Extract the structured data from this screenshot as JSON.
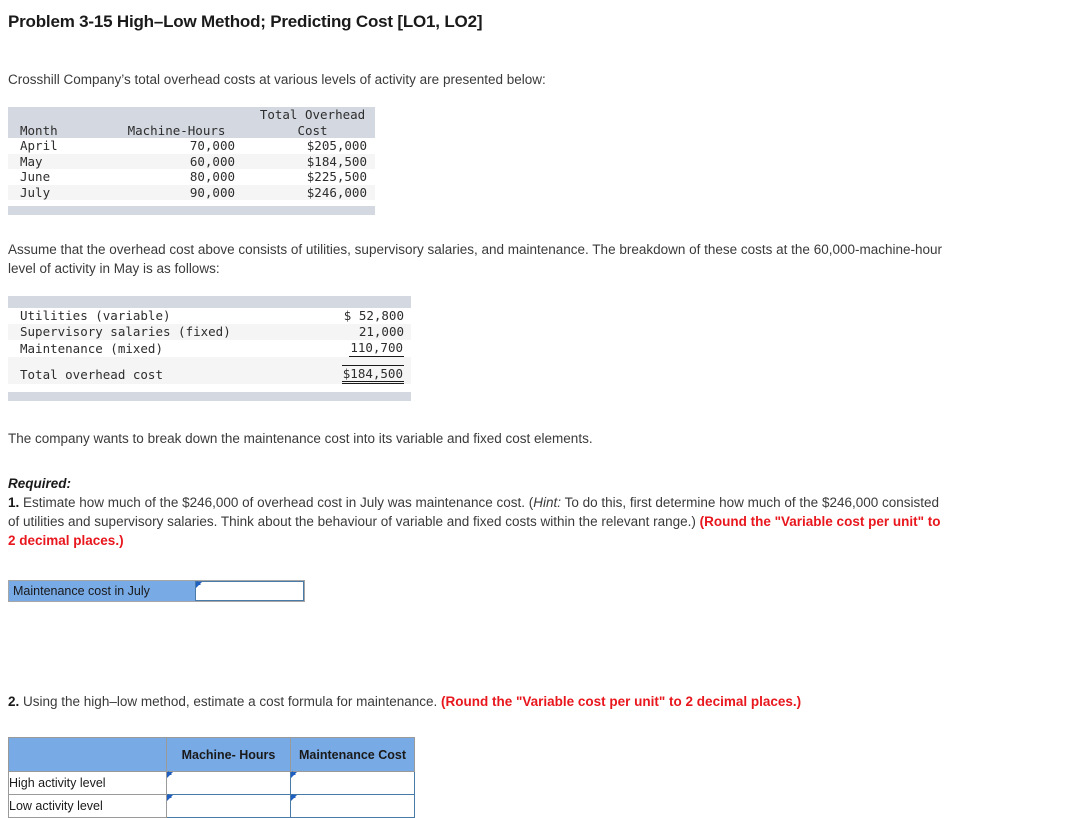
{
  "title": "Problem 3-15 High–Low Method; Predicting Cost [LO1, LO2]",
  "intro_paragraph": "Crosshill Company’s total overhead costs at various levels of activity are presented below:",
  "overhead_table": {
    "headers": {
      "month": "Month",
      "machine_hours": "Machine-Hours",
      "total_overhead_cost_line1": "Total Overhead",
      "total_overhead_cost_line2": "Cost"
    },
    "rows": [
      {
        "month": "April",
        "machine_hours": "70,000",
        "cost": "$205,000"
      },
      {
        "month": "May",
        "machine_hours": "60,000",
        "cost": "$184,500"
      },
      {
        "month": "June",
        "machine_hours": "80,000",
        "cost": "$225,500"
      },
      {
        "month": "July",
        "machine_hours": "90,000",
        "cost": "$246,000"
      }
    ]
  },
  "assume_paragraph": "Assume that the overhead cost above consists of utilities, supervisory salaries, and maintenance. The breakdown of these costs at the 60,000-machine-hour level of activity in May is as follows:",
  "breakdown_table": {
    "rows": [
      {
        "label": "Utilities (variable)",
        "amount": "$ 52,800"
      },
      {
        "label": "Supervisory salaries (fixed)",
        "amount": "21,000"
      },
      {
        "label": "Maintenance (mixed)",
        "amount": "110,700"
      }
    ],
    "total": {
      "label": "Total overhead cost",
      "amount": "$184,500"
    }
  },
  "breakdown_paragraph": "The company wants to break down the maintenance cost into its variable and fixed cost elements.",
  "required": {
    "heading": "Required:",
    "item1_number": "1.",
    "item1_part_a": " Estimate how much of the $246,000 of overhead cost in July was maintenance cost. (",
    "item1_hint_label": "Hint:",
    "item1_part_b": " To do this, first determine how much of the $246,000 consisted of utilities and supervisory salaries. Think about the behaviour of variable and fixed costs within the relevant range.) ",
    "item1_red_note": "(Round the \"Variable cost per unit\" to 2 decimal places.)"
  },
  "answer_row": {
    "label": "Maintenance cost in July",
    "value": "",
    "placeholder": ""
  },
  "part2": {
    "number": "2.",
    "text": " Using the high–low method, estimate a cost formula for maintenance. ",
    "red_note": "(Round the \"Variable cost per unit\" to 2 decimal places.)"
  },
  "activity_table": {
    "headers": [
      "",
      "Machine- Hours",
      "Maintenance Cost"
    ],
    "rows": [
      {
        "label": "High activity level",
        "machine_hours": "",
        "maintenance_cost": ""
      },
      {
        "label": "Low activity level",
        "machine_hours": "",
        "maintenance_cost": ""
      }
    ]
  },
  "colors": {
    "accent_blue": "#78aae6",
    "band_gray": "#d4d8e1",
    "stripe_gray": "#f5f5f5",
    "red": "#e8161d",
    "input_border": "#4a7ba8"
  }
}
